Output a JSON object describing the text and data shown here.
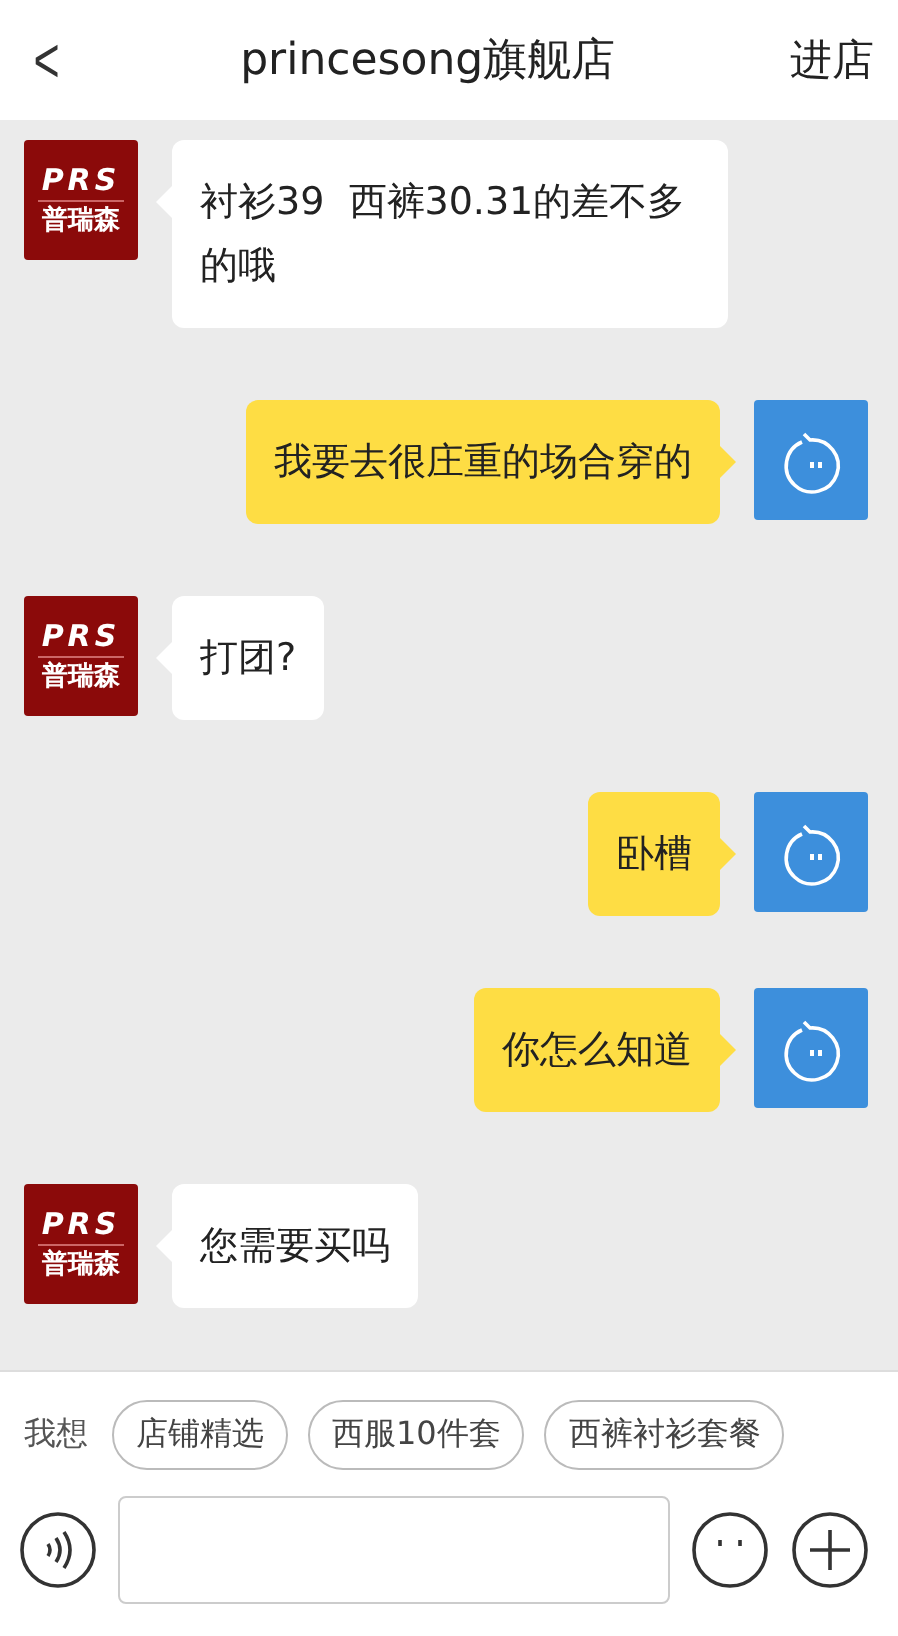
{
  "header": {
    "back": "<",
    "title": "princesong旗舰店",
    "action": "进店"
  },
  "messages": [
    {
      "kind": "incoming",
      "text": "衬衫39  西裤30.31的差不多的哦",
      "avatar": {
        "logo": "PRS",
        "name": "普瑞森"
      }
    },
    {
      "kind": "outgoing",
      "text": "我要去很庄重的场合穿的"
    },
    {
      "kind": "incoming",
      "text": "打团?",
      "avatar": {
        "logo": "PRS",
        "name": "普瑞森"
      }
    },
    {
      "kind": "outgoing",
      "text": "卧槽"
    },
    {
      "kind": "outgoing",
      "text": "你怎么知道"
    },
    {
      "kind": "incoming",
      "text": "您需要买吗",
      "avatar": {
        "logo": "PRS",
        "name": "普瑞森"
      }
    }
  ],
  "suggestions": {
    "label": "我想",
    "chips": [
      "店铺精选",
      "西服10件套",
      "西裤衬衫套餐"
    ]
  }
}
